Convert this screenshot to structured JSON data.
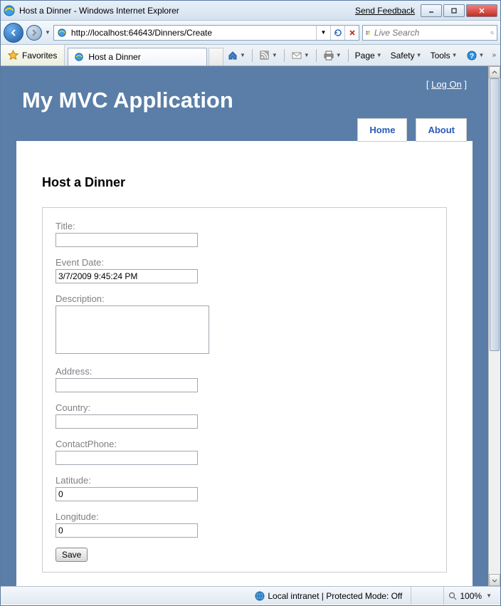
{
  "window": {
    "title": "Host a Dinner - Windows Internet Explorer",
    "feedback": "Send Feedback"
  },
  "nav": {
    "url": "http://localhost:64643/Dinners/Create",
    "search_placeholder": "Live Search"
  },
  "toolbar": {
    "favorites": "Favorites",
    "tab_title": "Host a Dinner",
    "menu_page": "Page",
    "menu_safety": "Safety",
    "menu_tools": "Tools"
  },
  "page": {
    "logon_text": "Log On",
    "app_title": "My MVC Application",
    "nav_home": "Home",
    "nav_about": "About",
    "heading": "Host a Dinner",
    "labels": {
      "title": "Title:",
      "eventdate": "Event Date:",
      "description": "Description:",
      "address": "Address:",
      "country": "Country:",
      "contactphone": "ContactPhone:",
      "latitude": "Latitude:",
      "longitude": "Longitude:"
    },
    "values": {
      "title": "",
      "eventdate": "3/7/2009 9:45:24 PM",
      "description": "",
      "address": "",
      "country": "",
      "contactphone": "",
      "latitude": "0",
      "longitude": "0"
    },
    "save_btn": "Save"
  },
  "status": {
    "zone": "Local intranet | Protected Mode: Off",
    "zoom": "100%"
  }
}
